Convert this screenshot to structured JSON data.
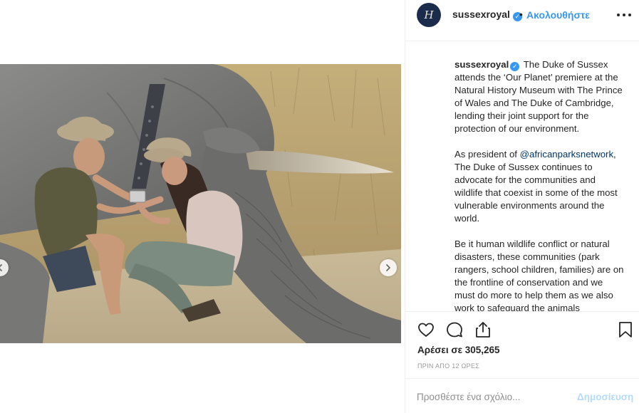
{
  "header": {
    "username": "sussexroyal",
    "verified": true,
    "separator": "•",
    "follow_label": "Ακολουθήστε",
    "avatar_monogram": "H",
    "more_icon": "more-horizontal-icon"
  },
  "media": {
    "alt_description": "",
    "next_icon": "chevron-right-icon",
    "prev_icon": "chevron-left-icon"
  },
  "caption": {
    "username": "sussexroyal",
    "para1": "The Duke of Sussex attends the ‘Our Planet’ premiere at the Natural History Museum with The Prince of Wales and The Duke of Cambridge, lending their joint support for the protection of our environment.",
    "para2_prefix": "As president of",
    "para2_mention": "@africanparksnetwork",
    "para2_suffix": ", The Duke of Sussex continues to advocate for the communities and wildlife that coexist in some of the most vulnerable environments around the world.",
    "para3": "Be it human wildlife conflict or natural disasters, these communities (park rangers, school children, families) are on the frontline of conservation and we must do more to help them as we also work to safeguard the animals"
  },
  "actions": {
    "like_icon": "heart-icon",
    "comment_icon": "comment-icon",
    "share_icon": "share-icon",
    "save_icon": "bookmark-icon",
    "likes_text": "Αρέσει σε 305,265",
    "timestamp": "ΠΡΙΝ ΑΠΟ 12 ΩΡΕΣ"
  },
  "comment_box": {
    "placeholder": "Προσθέστε ένα σχόλιο...",
    "post_label": "Δημοσίευση"
  },
  "colors": {
    "link_blue": "#3897f0",
    "mention_blue": "#003569",
    "disabled_post": "#b3dbff",
    "border": "#efefef",
    "text": "#262626",
    "muted": "#999999"
  }
}
